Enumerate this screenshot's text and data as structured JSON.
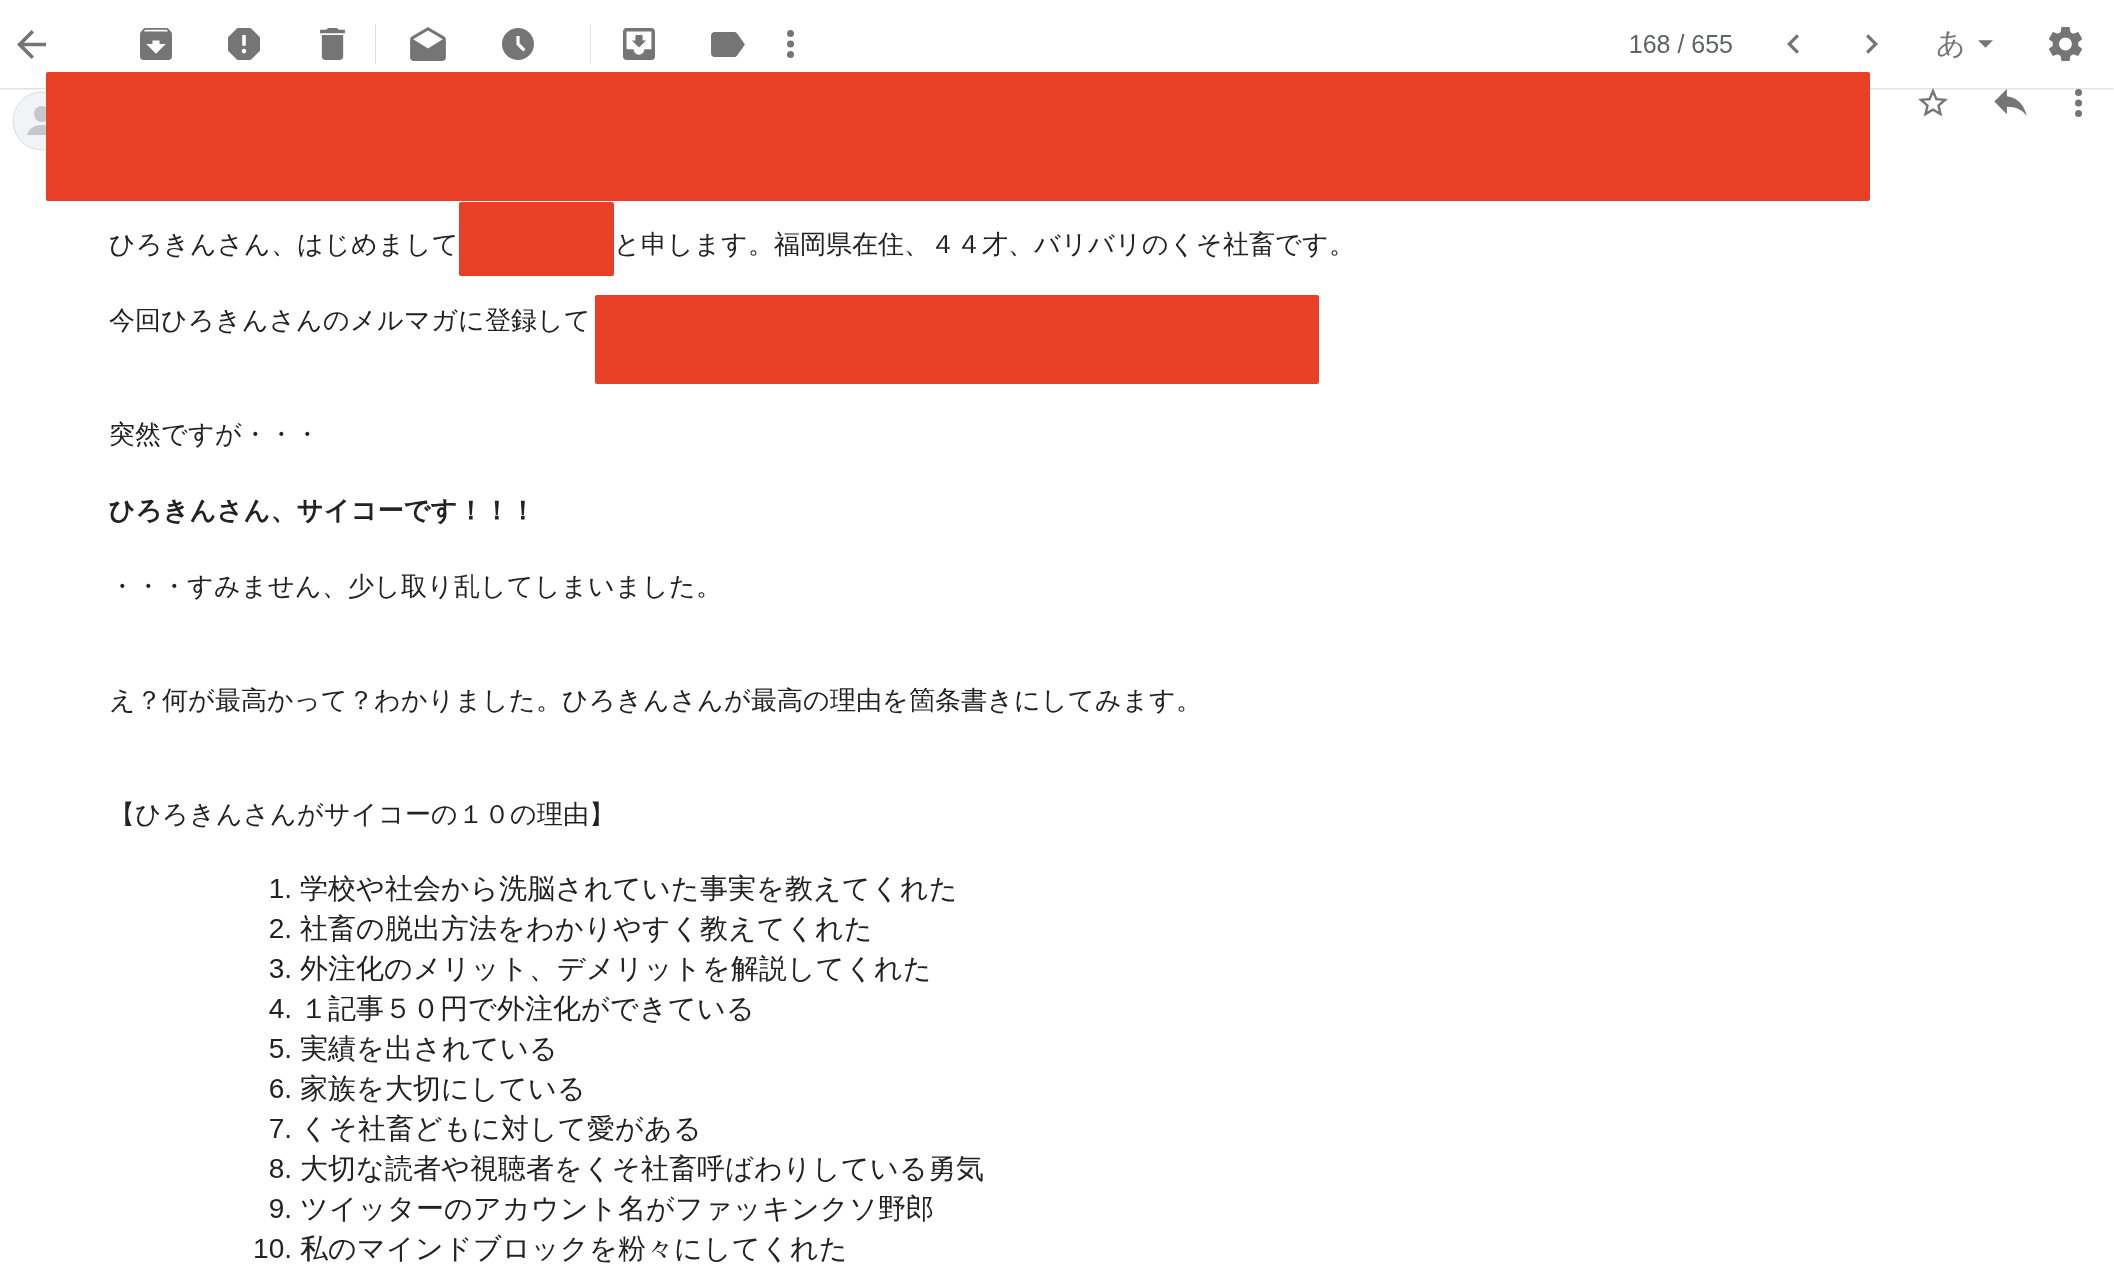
{
  "toolbar": {
    "counter": "168 / 655",
    "input_tool": "あ"
  },
  "message": {
    "paragraphs": [
      {
        "bold": false,
        "parts": [
          {
            "kind": "text",
            "text": "ひろきんさん、はじめまして"
          },
          {
            "kind": "redaction"
          },
          {
            "kind": "text",
            "text": "と申します。福岡県在住、４４才、バリバリのくそ社畜です。"
          }
        ]
      },
      {
        "bold": false,
        "parts": [
          {
            "kind": "text",
            "text": "今回ひろきんさんのメルマガに登録して"
          },
          {
            "kind": "redaction"
          }
        ]
      },
      {
        "bold": false,
        "parts": [
          {
            "kind": "text",
            "text": "突然ですが・・・"
          }
        ]
      },
      {
        "bold": true,
        "parts": [
          {
            "kind": "text",
            "text": "ひろきんさん、サイコーです！！！"
          }
        ]
      },
      {
        "bold": false,
        "parts": [
          {
            "kind": "text",
            "text": "・・・すみません、少し取り乱してしまいました。"
          }
        ]
      },
      {
        "bold": false,
        "parts": [
          {
            "kind": "text",
            "text": "え？何が最高かって？わかりました。ひろきんさんが最高の理由を箇条書きにしてみます。"
          }
        ]
      },
      {
        "bold": false,
        "parts": [
          {
            "kind": "text",
            "text": "【ひろきんさんがサイコーの１０の理由】"
          }
        ]
      }
    ],
    "reasons": [
      {
        "number": "1.",
        "text": "学校や社会から洗脳されていた事実を教えてくれた"
      },
      {
        "number": "2.",
        "text": "社畜の脱出方法をわかりやすく教えてくれた"
      },
      {
        "number": "3.",
        "text": "外注化のメリット、デメリットを解説してくれた"
      },
      {
        "number": "4.",
        "text": "１記事５０円で外注化ができている"
      },
      {
        "number": "5.",
        "text": "実績を出されている"
      },
      {
        "number": "6.",
        "text": "家族を大切にしている"
      },
      {
        "number": "7.",
        "text": "くそ社畜どもに対して愛がある"
      },
      {
        "number": "8.",
        "text": "大切な読者や視聴者をくそ社畜呼ばわりしている勇気"
      },
      {
        "number": "9.",
        "text": "ツイッターのアカウント名がファッキンクソ野郎"
      },
      {
        "number": "10.",
        "text": "私のマインドブロックを粉々にしてくれた"
      }
    ]
  }
}
